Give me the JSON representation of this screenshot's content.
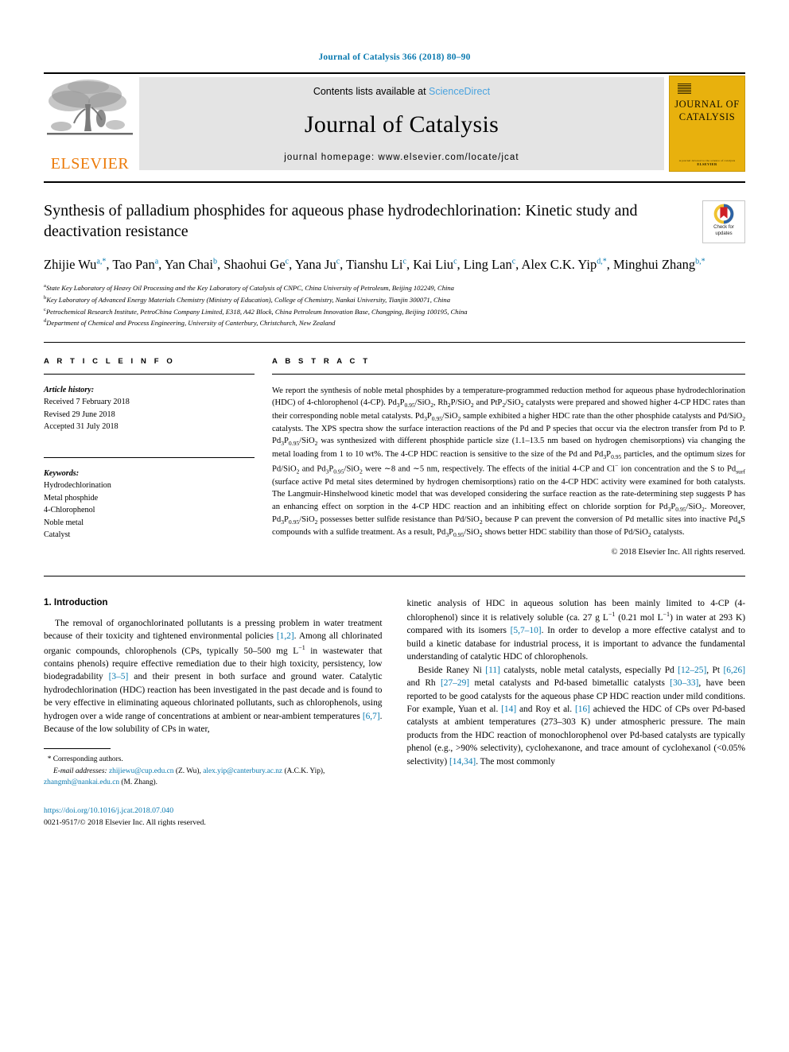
{
  "running_head": "Journal of Catalysis 366 (2018) 80–90",
  "masthead": {
    "publisher_name": "ELSEVIER",
    "contents_prefix": "Contents lists available at ",
    "sciencedirect": "ScienceDirect",
    "journal_title": "Journal of Catalysis",
    "homepage": "journal homepage: www.elsevier.com/locate/jcat",
    "cover_title_line1": "JOURNAL OF",
    "cover_title_line2": "CATALYSIS",
    "cover_footer_small": "A journal devoted to the science of catalysis",
    "cover_footer_publisher": "ELSEVIER"
  },
  "title": "Synthesis of palladium phosphides for aqueous phase hydrodechlorination: Kinetic study and deactivation resistance",
  "crossmark": {
    "line1": "Check for",
    "line2": "updates"
  },
  "authors": [
    {
      "name": "Zhijie Wu",
      "sup": "a,*",
      "sep": ", "
    },
    {
      "name": "Tao Pan",
      "sup": "a",
      "sep": ", "
    },
    {
      "name": "Yan Chai",
      "sup": "b",
      "sep": ", "
    },
    {
      "name": "Shaohui Ge",
      "sup": "c",
      "sep": ", "
    },
    {
      "name": "Yana Ju",
      "sup": "c",
      "sep": ", "
    },
    {
      "name": "Tianshu Li",
      "sup": "c",
      "sep": ", "
    },
    {
      "name": "Kai Liu",
      "sup": "c",
      "sep": ", "
    },
    {
      "name": "Ling Lan",
      "sup": "c",
      "sep": ", "
    },
    {
      "name": "Alex C.K. Yip",
      "sup": "d,*",
      "sep": ", "
    },
    {
      "name": "Minghui Zhang",
      "sup": "b,*",
      "sep": ""
    }
  ],
  "affiliations": [
    {
      "marker": "a",
      "text": "State Key Laboratory of Heavy Oil Processing and the Key Laboratory of Catalysis of CNPC, China University of Petroleum, Beijing 102249, China"
    },
    {
      "marker": "b",
      "text": "Key Laboratory of Advanced Energy Materials Chemistry (Ministry of Education), College of Chemistry, Nankai University, Tianjin 300071, China"
    },
    {
      "marker": "c",
      "text": "Petrochemical Research Institute, PetroChina Company Limited, E318, A42 Block, China Petroleum Innovation Base, Changping, Beijing 100195, China"
    },
    {
      "marker": "d",
      "text": "Department of Chemical and Process Engineering, University of Canterbury, Christchurch, New Zealand"
    }
  ],
  "article_info": {
    "heading": "A R T I C L E   I N F O",
    "history_label": "Article history:",
    "history": [
      "Received 7 February 2018",
      "Revised 29 June 2018",
      "Accepted 31 July 2018"
    ],
    "keywords_label": "Keywords:",
    "keywords": [
      "Hydrodechlorination",
      "Metal phosphide",
      "4-Chlorophenol",
      "Noble metal",
      "Catalyst"
    ]
  },
  "abstract": {
    "heading": "A B S T R A C T",
    "copyright": "© 2018 Elsevier Inc. All rights reserved."
  },
  "introduction": {
    "heading": "1. Introduction"
  },
  "footnote": {
    "corresponding": "Corresponding authors.",
    "email_label": "E-mail addresses:",
    "email1": "zhijiewu@cup.edu.cn",
    "email1_owner": "(Z. Wu),",
    "email2": "alex.yip@canterbury.ac.nz",
    "email2_owner": "(A.C.K. Yip),",
    "email3": "zhangmh@nankai.edu.cn",
    "email3_owner": "(M. Zhang)."
  },
  "doi": {
    "url": "https://doi.org/10.1016/j.jcat.2018.07.040",
    "issn_line": "0021-9517/© 2018 Elsevier Inc. All rights reserved."
  },
  "colors": {
    "link_blue": "#0a7ab0",
    "sciencedirect_blue": "#4aa3df",
    "elsevier_orange": "#ec7a08",
    "cover_yellow": "#e8b10d",
    "masthead_gray": "#e4e4e4"
  }
}
